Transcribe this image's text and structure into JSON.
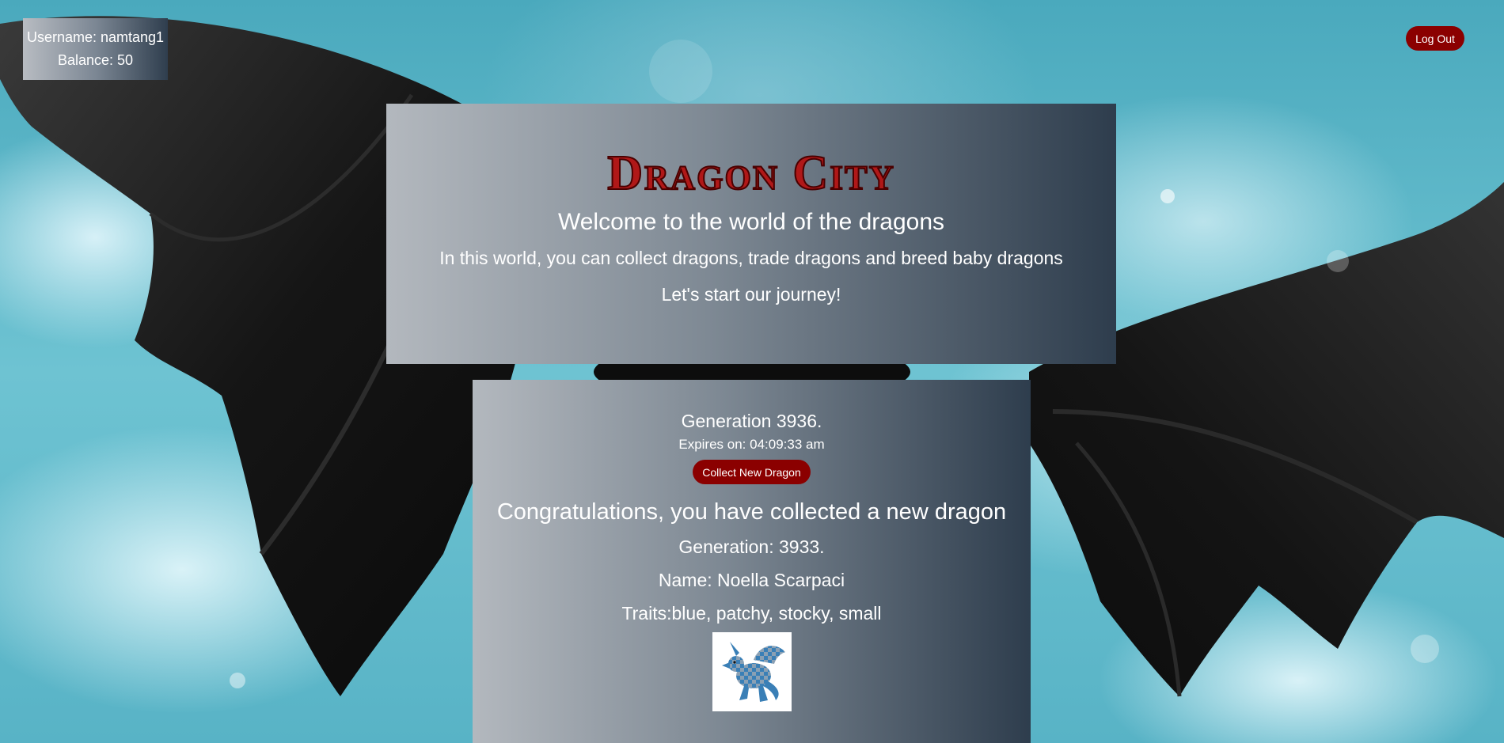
{
  "user": {
    "username_text": "Username: namtang1",
    "balance_text": "Balance: 50"
  },
  "header": {
    "logout_label": "Log Out"
  },
  "hero": {
    "logo_text": "Dragon City",
    "welcome": "Welcome to the world of the dragons",
    "intro": "In this world, you can collect dragons, trade dragons and breed baby dragons",
    "journey": "Let's start our journey!"
  },
  "collect": {
    "generation_text": "Generation 3936.",
    "expires_text": "Expires on: 04:09:33 am",
    "collect_label": "Collect New Dragon",
    "congrats": "Congratulations, you have collected a new dragon",
    "new_generation": "Generation: 3933.",
    "name": "Name: Noella Scarpaci",
    "traits": "Traits:blue, patchy, stocky, small"
  },
  "colors": {
    "accent_button": "#8b0000",
    "logo_red": "#b01818",
    "dragon_blue": "#3a7fb6"
  }
}
